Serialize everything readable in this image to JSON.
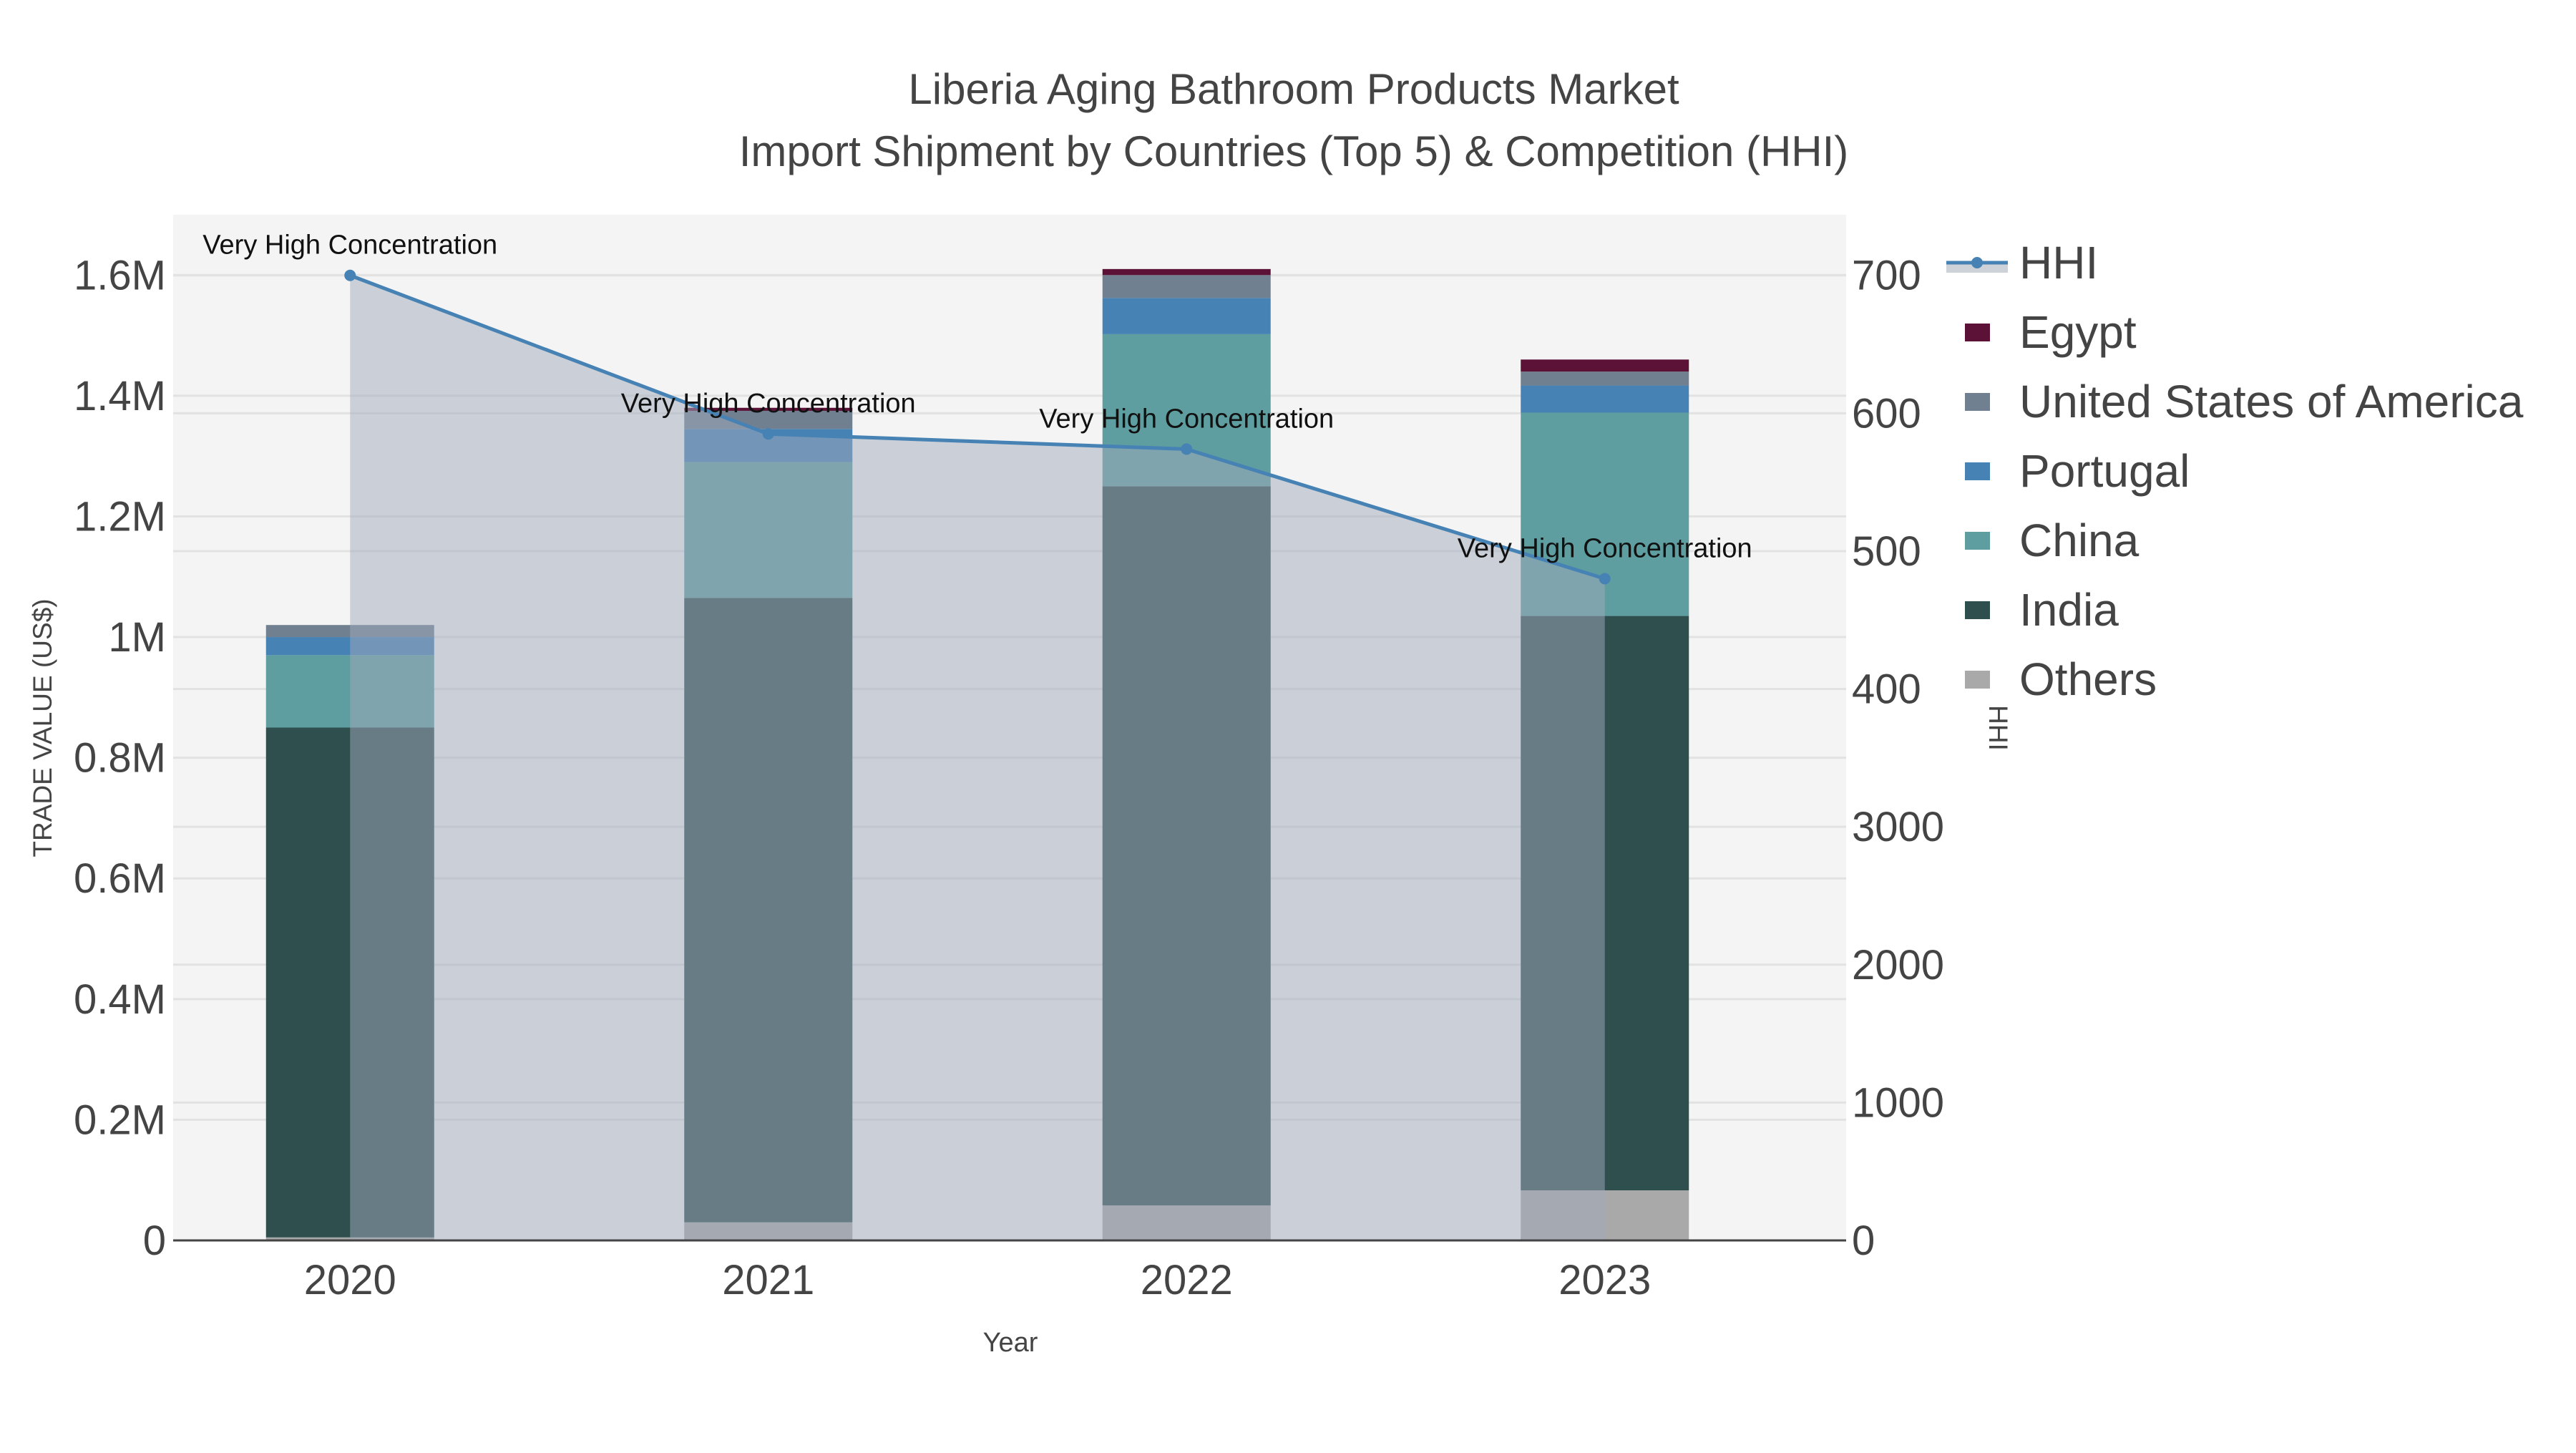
{
  "chart_data": {
    "type": "bar",
    "title": "Liberia Aging Bathroom Products Market",
    "subtitle": "Import Shipment by Countries (Top 5) & Competition (HHI)",
    "xlabel": "Year",
    "ylabel": "TRADE VALUE (US$)",
    "y2label": "HHI",
    "categories": [
      "2020",
      "2021",
      "2022",
      "2023"
    ],
    "ylim": [
      0,
      1700000
    ],
    "y2lim": [
      0,
      7440
    ],
    "yticks": [
      0,
      200000,
      400000,
      600000,
      800000,
      1000000,
      1200000,
      1400000,
      1600000
    ],
    "ytick_labels": [
      "0",
      "0.2M",
      "0.4M",
      "0.6M",
      "0.8M",
      "1M",
      "1.2M",
      "1.4M",
      "1.6M"
    ],
    "y2ticks": [
      0,
      1000,
      2000,
      3000,
      4000,
      5000,
      6000,
      7000
    ],
    "y2tick_labels": [
      "0",
      "1000",
      "2000",
      "3000",
      "400",
      "500",
      "600",
      "700"
    ],
    "grid": true,
    "legend_position": "right",
    "series": [
      {
        "name": "Others",
        "color": "#a9a9a9",
        "values": [
          5000,
          30000,
          58000,
          83000
        ]
      },
      {
        "name": "India",
        "color": "#2f4f4f",
        "values": [
          845000,
          1035000,
          1192000,
          952000
        ]
      },
      {
        "name": "China",
        "color": "#5f9ea0",
        "values": [
          120000,
          225000,
          252000,
          337000
        ]
      },
      {
        "name": "Portugal",
        "color": "#4682b4",
        "values": [
          30000,
          55000,
          60000,
          45000
        ]
      },
      {
        "name": "United States of America",
        "color": "#708090",
        "values": [
          20000,
          30000,
          38000,
          23000
        ]
      },
      {
        "name": "Egypt",
        "color": "#5c1237",
        "values": [
          0,
          5000,
          10000,
          20000
        ]
      }
    ],
    "hhi": {
      "name": "HHI",
      "color": "#4682b4",
      "values": [
        7000,
        5850,
        5740,
        4800
      ]
    },
    "annotations": [
      "Very High Concentration",
      "Very High Concentration",
      "Very High Concentration",
      "Very High Concentration"
    ],
    "legend_order": [
      "HHI",
      "Egypt",
      "United States of America",
      "Portugal",
      "China",
      "India",
      "Others"
    ]
  }
}
